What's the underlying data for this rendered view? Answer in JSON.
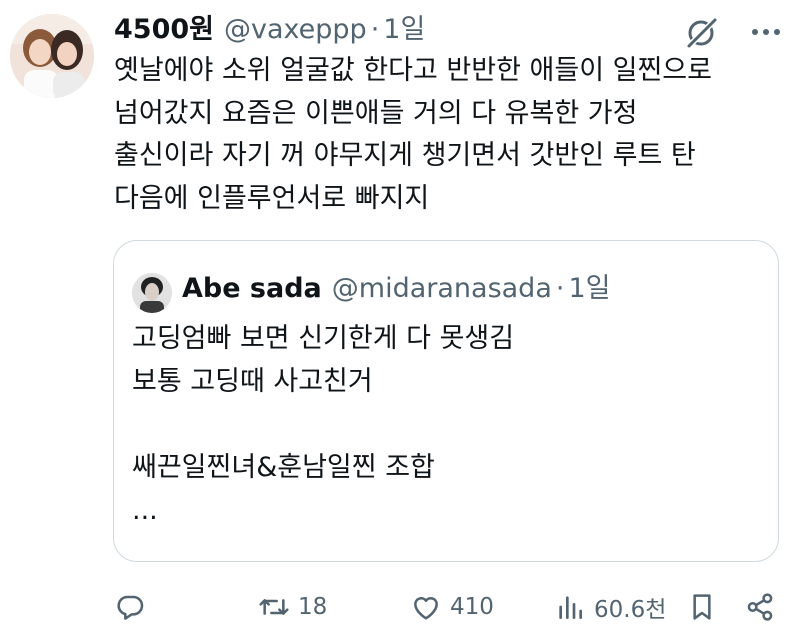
{
  "tweet": {
    "author_name": "4500원",
    "author_handle": "@vaxeppp",
    "separator": "·",
    "time": "1일",
    "lines": [
      "옛날에야 소위 얼굴값 한다고 반반한 애들이 일찐으로",
      "넘어갔지 요즘은 이쁜애들 거의 다 유복한 가정",
      "출신이라 자기 꺼 야무지게 챙기면서 갓반인 루트 탄",
      "다음에 인플루언서로 빠지지"
    ]
  },
  "quote": {
    "author_name": "Abe sada",
    "author_handle": "@midaranasada",
    "separator": "·",
    "time": "1일",
    "lines": [
      "고딩엄빠 보면 신기한게 다 못생김",
      "보통 고딩때 사고친거",
      "",
      "쌔끈일찐녀&훈남일찐 조합",
      "..."
    ]
  },
  "actions": {
    "reply_icon": "reply-icon",
    "retweet_count": "18",
    "like_count": "410",
    "views_count": "60.6천"
  },
  "colors": {
    "text": "#0f1419",
    "muted": "#536471",
    "border": "#cfd9de"
  }
}
